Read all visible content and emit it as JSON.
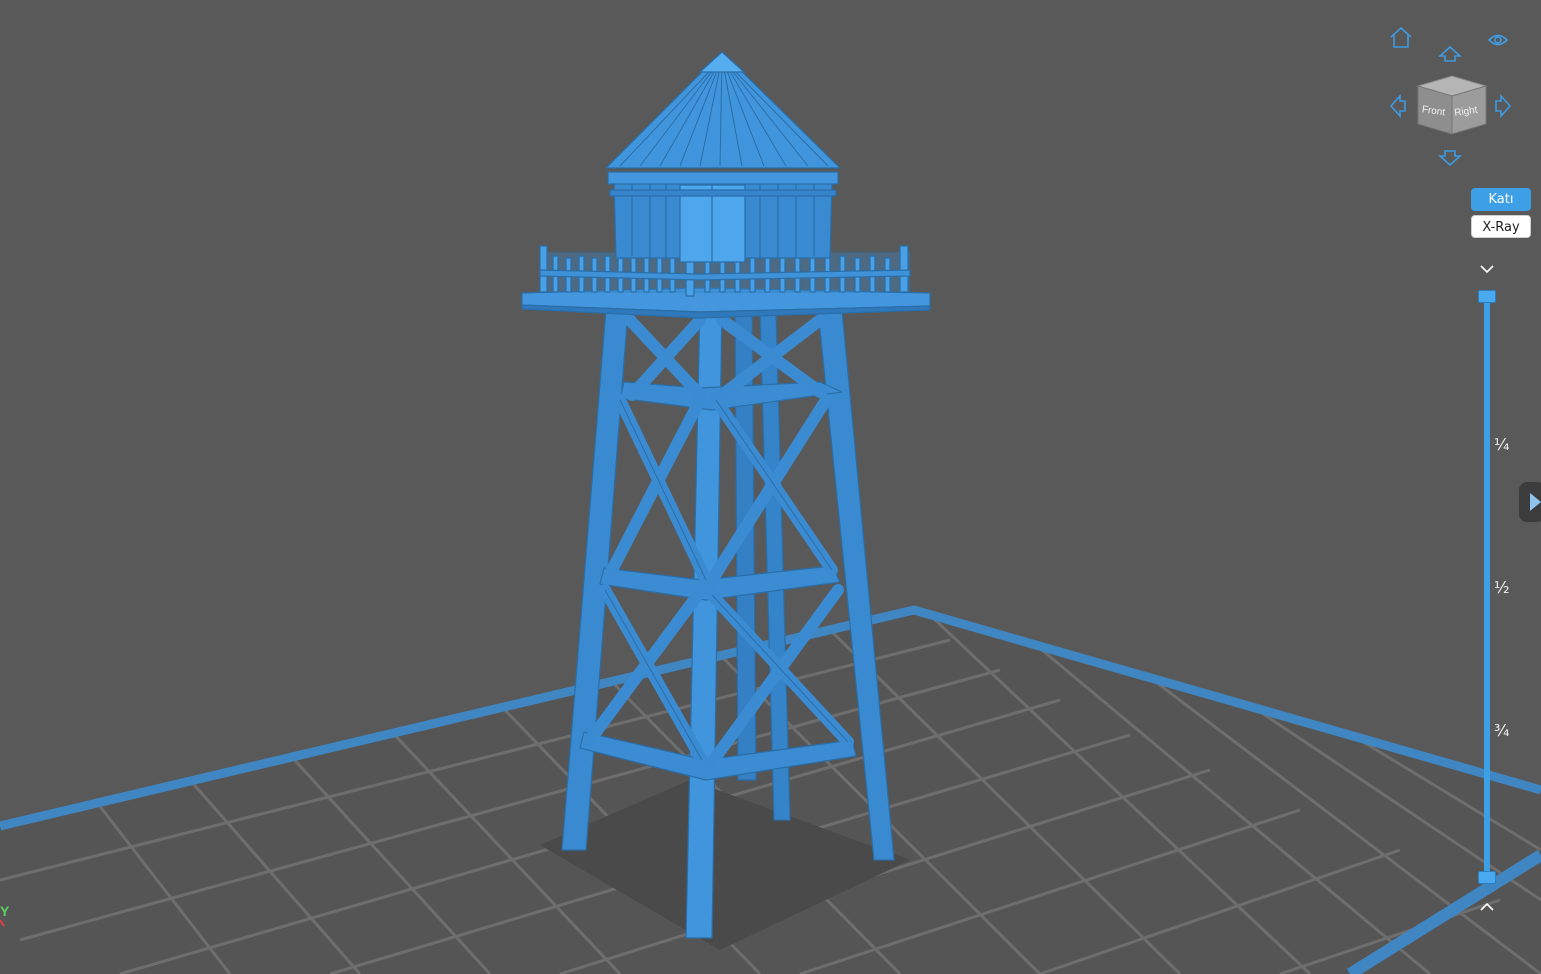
{
  "viewcube": {
    "front_label": "Front",
    "right_label": "Right"
  },
  "render_modes": {
    "solid_label": "Katı",
    "xray_label": "X-Ray",
    "active": "solid"
  },
  "layer_slider": {
    "tick_quarter": "¼",
    "tick_half": "½",
    "tick_three_quarter": "¾",
    "upper_position": 0,
    "lower_position": 1
  },
  "axis_indicator": {
    "y_label": "Y"
  },
  "colors": {
    "background": "#595959",
    "model": "#3d8fd6",
    "accent": "#3da0e6",
    "build_plate_border": "#3f86c2",
    "grid_lines": "#6a6a6a"
  },
  "icons": {
    "home": "home-icon",
    "visibility": "eye-icon",
    "rotate_up": "arrow-up-icon",
    "rotate_down": "arrow-down-icon",
    "rotate_left": "arrow-left-icon",
    "rotate_right": "arrow-right-icon",
    "collapse": "chevron-down-icon",
    "expand": "chevron-up-icon",
    "side_panel": "play-triangle-icon"
  }
}
